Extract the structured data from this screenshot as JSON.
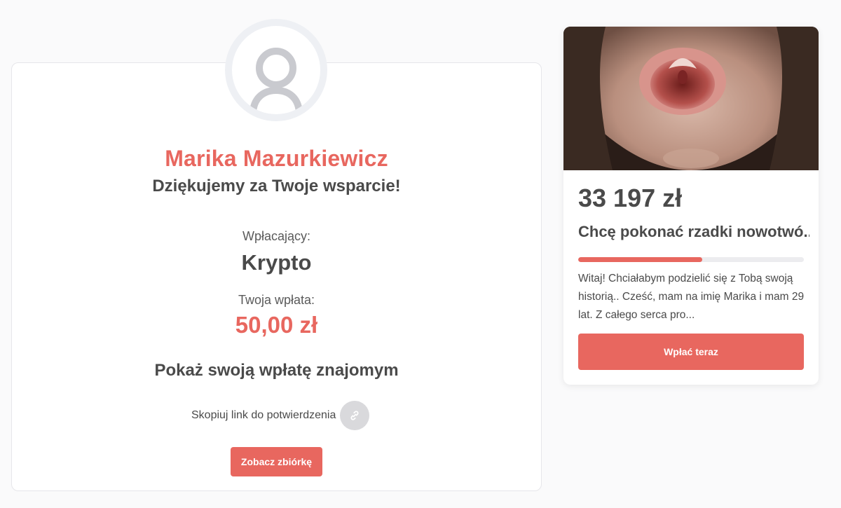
{
  "confirmation": {
    "donor_name": "Marika Mazurkiewicz",
    "thanks": "Dziękujemy za Twoje wsparcie!",
    "donor_label": "Wpłacający:",
    "donor_value": "Krypto",
    "amount_label": "Twoja wpłata:",
    "amount_value": "50,00 zł",
    "share_heading": "Pokaż swoją wpłatę znajomym",
    "copy_link_label": "Skopiuj link do potwierdzenia",
    "see_button": "Zobacz zbiórkę",
    "icons": {
      "avatar": "user-avatar-icon",
      "copy": "link-icon"
    }
  },
  "fundraiser": {
    "amount": "33 197 zł",
    "title": "Chcę pokonać rzadki nowotwó...",
    "progress_percent": 55,
    "description": "Witaj! Chciałabym podzielić się z Tobą swoją his­torią.. Cześć, mam na imię Marika i mam 29 lat. Z całego serca pro...",
    "pay_button": "Wpłać teraz"
  },
  "colors": {
    "accent": "#e8675f",
    "text": "#4a4a4a",
    "background": "#fafafb"
  }
}
